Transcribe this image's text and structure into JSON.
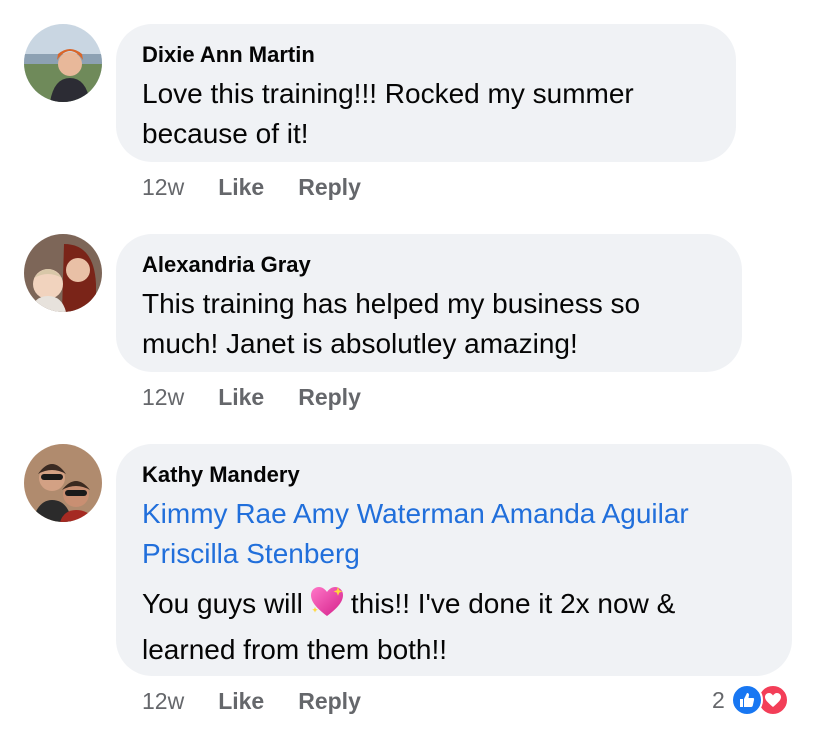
{
  "comments": [
    {
      "author": "Dixie Ann Martin",
      "text_lines": [
        "Love this training!!! Rocked my summer",
        "because of it!"
      ],
      "time": "12w",
      "like_label": "Like",
      "reply_label": "Reply",
      "avatar": "photo-avatar"
    },
    {
      "author": "Alexandria Gray",
      "text_lines": [
        "This training has helped my business so",
        "much! Janet is absolutley amazing!"
      ],
      "time": "12w",
      "like_label": "Like",
      "reply_label": "Reply",
      "avatar": "photo-avatar"
    },
    {
      "author": "Kathy Mandery",
      "tags": [
        "Kimmy Rae",
        "Amy Waterman",
        "Amanda Aguilar",
        "Priscilla Stenberg"
      ],
      "text_before_emoji": "You guys will",
      "emoji": "sparkling-heart",
      "text_after_emoji": "this!! I've done it 2x now &",
      "text_line2": "learned from them both!!",
      "time": "12w",
      "like_label": "Like",
      "reply_label": "Reply",
      "reaction_count": "2",
      "reactions": [
        "like-icon",
        "love-icon"
      ],
      "avatar": "photo-avatar"
    }
  ],
  "colors": {
    "bubble": "#f0f2f5",
    "link": "#216fdb",
    "meta": "#65676b",
    "like": "#1877f2",
    "love": "#f33e58"
  }
}
